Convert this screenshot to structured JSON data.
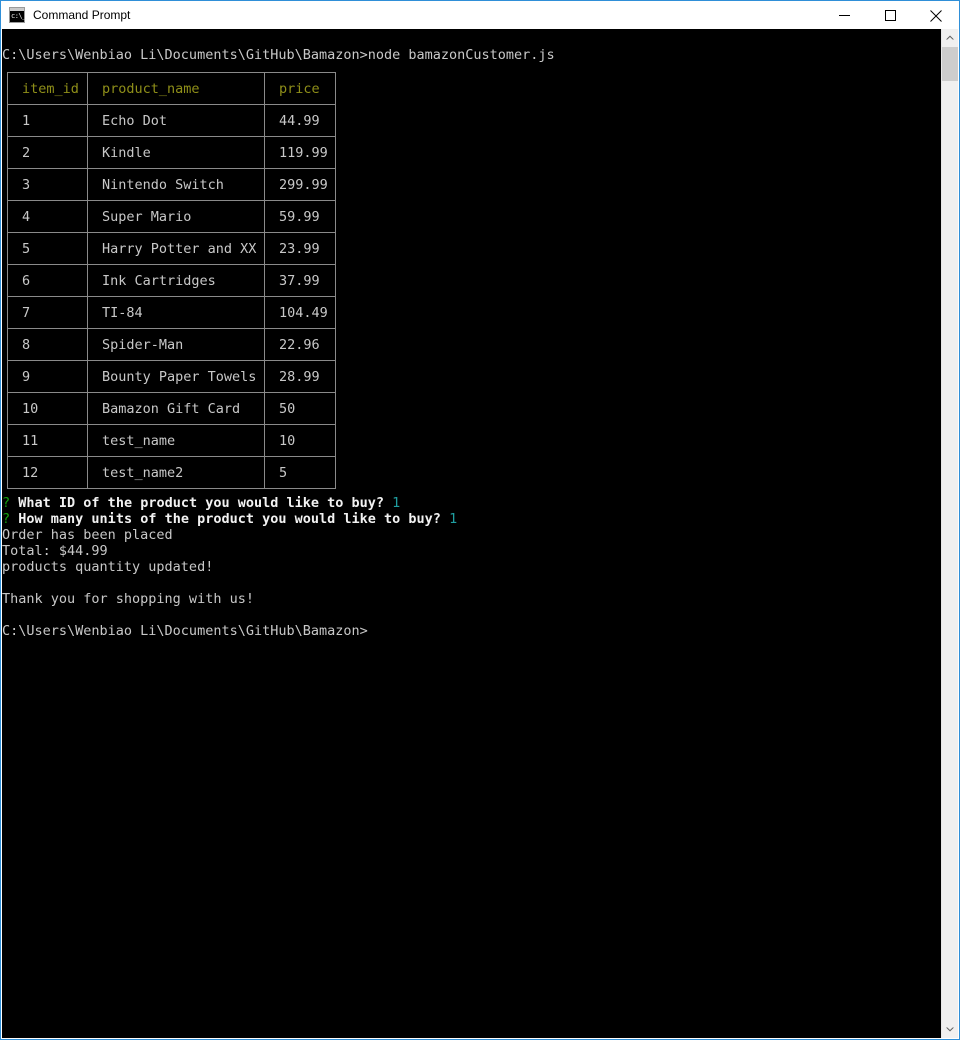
{
  "window": {
    "title": "Command Prompt",
    "icon": "console-icon",
    "minimize_label": "Minimize",
    "maximize_label": "Maximize",
    "close_label": "Close",
    "border_color": "#2f8fd8"
  },
  "terminal": {
    "background": "#000000",
    "foreground": "#c8c8c8",
    "header_color": "#8f8f19",
    "prompt_color": "#13a10e",
    "answer_color": "#1f9ea0",
    "command_line": "C:\\Users\\Wenbiao Li\\Documents\\GitHub\\Bamazon>node bamazonCustomer.js",
    "final_prompt": "C:\\Users\\Wenbiao Li\\Documents\\GitHub\\Bamazon>"
  },
  "table": {
    "headers": [
      "item_id",
      "product_name",
      "price"
    ],
    "rows": [
      {
        "item_id": "1",
        "product_name": "Echo Dot",
        "price": "44.99"
      },
      {
        "item_id": "2",
        "product_name": "Kindle",
        "price": "119.99"
      },
      {
        "item_id": "3",
        "product_name": "Nintendo Switch",
        "price": "299.99"
      },
      {
        "item_id": "4",
        "product_name": "Super Mario",
        "price": "59.99"
      },
      {
        "item_id": "5",
        "product_name": "Harry Potter and XX",
        "price": "23.99"
      },
      {
        "item_id": "6",
        "product_name": "Ink Cartridges",
        "price": "37.99"
      },
      {
        "item_id": "7",
        "product_name": "TI-84",
        "price": "104.49"
      },
      {
        "item_id": "8",
        "product_name": "Spider-Man",
        "price": "22.96"
      },
      {
        "item_id": "9",
        "product_name": "Bounty Paper Towels",
        "price": "28.99"
      },
      {
        "item_id": "10",
        "product_name": "Bamazon Gift Card",
        "price": "50"
      },
      {
        "item_id": "11",
        "product_name": "test_name",
        "price": "10"
      },
      {
        "item_id": "12",
        "product_name": "test_name2",
        "price": "5"
      }
    ]
  },
  "output": {
    "q1_mark": "?",
    "q1_text": "What ID of the product you would like to buy?",
    "q1_answer": "1",
    "q2_mark": "?",
    "q2_text": "How many units of the product you would like to buy?",
    "q2_answer": "1",
    "line_order": "Order has been placed",
    "line_total": "Total: $44.99",
    "line_updated": "products quantity updated!",
    "line_thanks": "Thank you for shopping with us!"
  },
  "scrollbar": {
    "up_arrow": "chevron-up-icon",
    "down_arrow": "chevron-down-icon",
    "thumb": "scrollbar-thumb"
  }
}
